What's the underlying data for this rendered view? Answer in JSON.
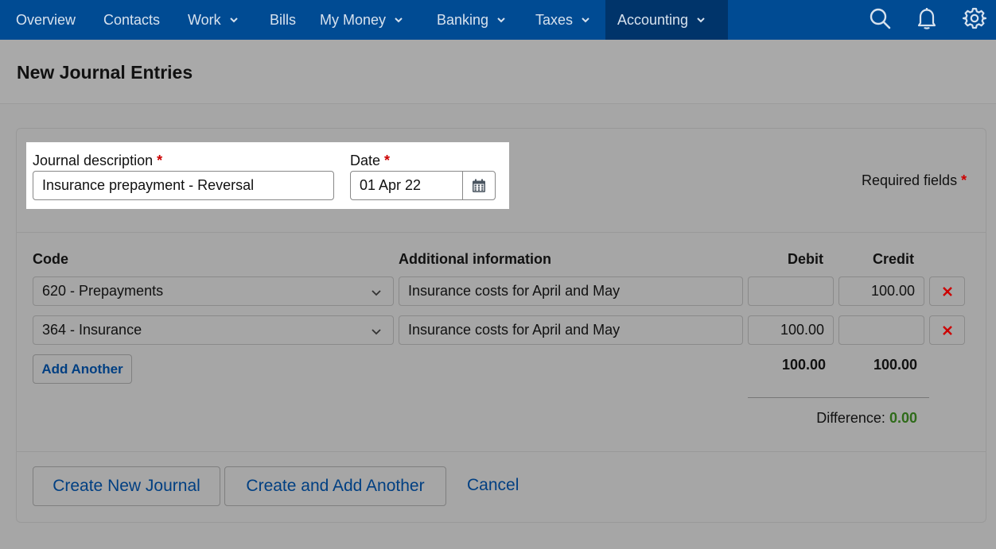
{
  "nav": {
    "items": [
      {
        "label": "Overview",
        "has_menu": false
      },
      {
        "label": "Contacts",
        "has_menu": false
      },
      {
        "label": "Work",
        "has_menu": true
      },
      {
        "label": "Bills",
        "has_menu": false
      },
      {
        "label": "My Money",
        "has_menu": true
      },
      {
        "label": "Banking",
        "has_menu": true
      },
      {
        "label": "Taxes",
        "has_menu": true
      },
      {
        "label": "Accounting",
        "has_menu": true,
        "active": true
      }
    ],
    "icons": [
      "search-icon",
      "bell-icon",
      "gear-icon"
    ]
  },
  "page": {
    "title": "New Journal Entries"
  },
  "form": {
    "description_label": "Journal description",
    "description_value": "Insurance prepayment - Reversal",
    "date_label": "Date",
    "date_value": "01 Apr 22",
    "required_asterisk": "*",
    "required_note": "Required fields"
  },
  "table": {
    "headers": {
      "code": "Code",
      "info": "Additional information",
      "debit": "Debit",
      "credit": "Credit"
    },
    "rows": [
      {
        "code": "620 - Prepayments",
        "info": "Insurance costs for April and May",
        "debit": "",
        "credit": "100.00"
      },
      {
        "code": "364 - Insurance",
        "info": "Insurance costs for April and May",
        "debit": "100.00",
        "credit": ""
      }
    ],
    "add_label": "Add Another",
    "total_debit": "100.00",
    "total_credit": "100.00",
    "difference_label": "Difference:",
    "difference_value": "0.00"
  },
  "actions": {
    "create": "Create New Journal",
    "create_add": "Create and Add Another",
    "cancel": "Cancel"
  },
  "colors": {
    "nav_bg": "#004b93",
    "nav_active_bg": "#00346a",
    "link": "#003f82",
    "required": "#cc0000",
    "difference": "#2f6b1a",
    "delete": "#cc0000"
  }
}
